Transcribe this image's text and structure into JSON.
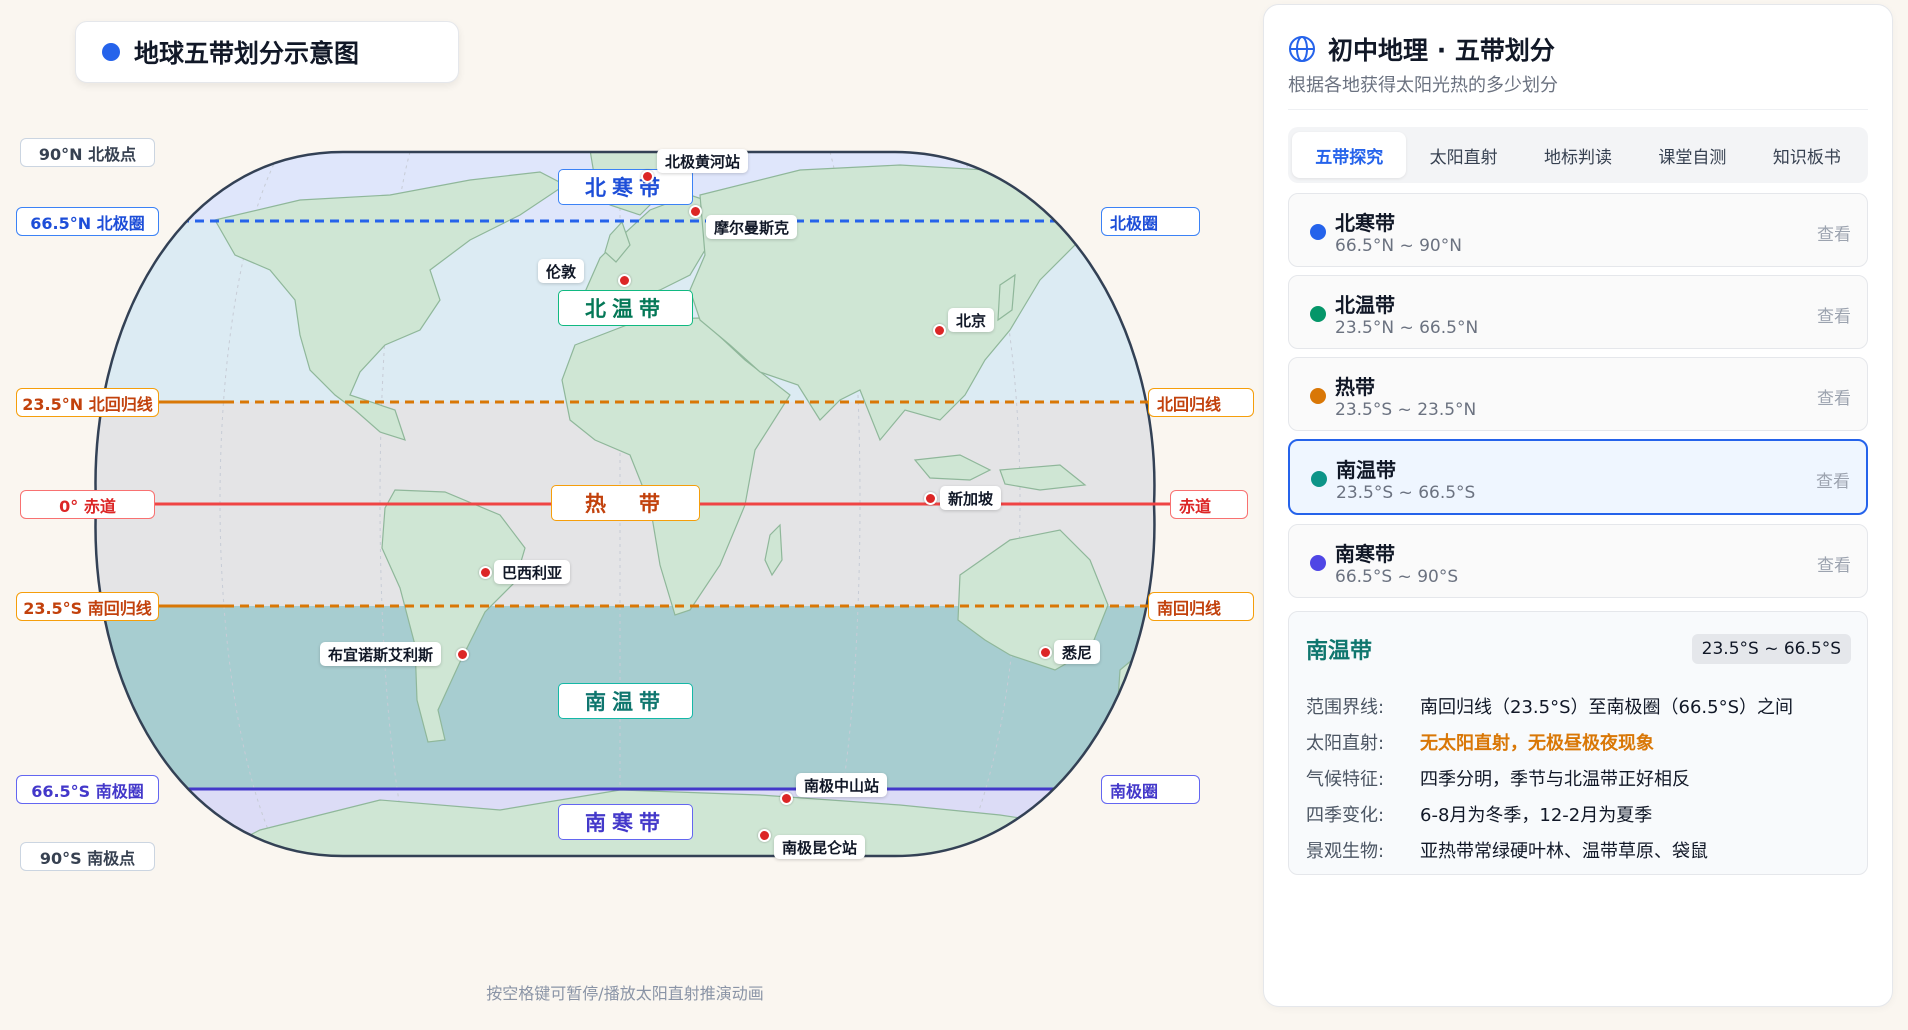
{
  "header": {
    "title": "地球五带划分示意图",
    "accent": "#2563eb"
  },
  "map": {
    "left_labels": [
      {
        "key": "np",
        "text": "90°N 北极点",
        "color": "#374151"
      },
      {
        "key": "arctic",
        "text": "66.5°N 北极圈",
        "color": "#1d4ed8"
      },
      {
        "key": "cancer",
        "text": "23.5°N 北回归线",
        "color": "#c2410c"
      },
      {
        "key": "equator",
        "text": "0° 赤道",
        "color": "#dc2626"
      },
      {
        "key": "capricorn",
        "text": "23.5°S 南回归线",
        "color": "#c2410c"
      },
      {
        "key": "antarctic",
        "text": "66.5°S 南极圈",
        "color": "#4338ca"
      },
      {
        "key": "sp",
        "text": "90°S 南极点",
        "color": "#374151"
      }
    ],
    "right_labels": [
      {
        "key": "arctic",
        "text": "北极圈",
        "color": "#1d4ed8"
      },
      {
        "key": "cancer",
        "text": "北回归线",
        "color": "#c2410c"
      },
      {
        "key": "equator",
        "text": "赤道",
        "color": "#dc2626"
      },
      {
        "key": "capricorn",
        "text": "南回归线",
        "color": "#c2410c"
      },
      {
        "key": "antarctic",
        "text": "南极圈",
        "color": "#4338ca"
      }
    ],
    "zone_labels": [
      {
        "text": "北寒带",
        "color": "#1d4ed8"
      },
      {
        "text": "北温带",
        "color": "#047857"
      },
      {
        "text": "热　带",
        "color": "#c2410c"
      },
      {
        "text": "南温带",
        "color": "#0f766e"
      },
      {
        "text": "南寒带",
        "color": "#4338ca"
      }
    ],
    "cities": [
      {
        "name": "北极黄河站"
      },
      {
        "name": "摩尔曼斯克"
      },
      {
        "name": "伦敦"
      },
      {
        "name": "北京"
      },
      {
        "name": "新加坡"
      },
      {
        "name": "巴西利亚"
      },
      {
        "name": "布宜诺斯艾利斯"
      },
      {
        "name": "悉尼"
      },
      {
        "name": "南极中山站"
      },
      {
        "name": "南极昆仑站"
      }
    ],
    "hint": "按空格键可暂停/播放太阳直射推演动画"
  },
  "panel": {
    "title": "初中地理 · 五带划分",
    "subtitle": "根据各地获得太阳光热的多少划分",
    "tabs": [
      "五带探究",
      "太阳直射",
      "地标判读",
      "课堂自测",
      "知识板书"
    ],
    "active_tab": 0,
    "zones": [
      {
        "name": "北寒带",
        "range": "66.5°N ~ 90°N",
        "color": "#2563eb",
        "view": "查看"
      },
      {
        "name": "北温带",
        "range": "23.5°N ~ 66.5°N",
        "color": "#059669",
        "view": "查看"
      },
      {
        "name": "热带",
        "range": "23.5°S ~ 23.5°N",
        "color": "#d97706",
        "view": "查看"
      },
      {
        "name": "南温带",
        "range": "23.5°S ~ 66.5°S",
        "color": "#0d9488",
        "view": "查看"
      },
      {
        "name": "南寒带",
        "range": "66.5°S ~ 90°S",
        "color": "#4f46e5",
        "view": "查看"
      }
    ],
    "active_zone": 3,
    "detail": {
      "title": "南温带",
      "badge": "23.5°S ~ 66.5°S",
      "rows": [
        {
          "key": "范围界线:",
          "value": "南回归线（23.5°S）至南极圈（66.5°S）之间"
        },
        {
          "key": "太阳直射:",
          "value": "无太阳直射，无极昼极夜现象"
        },
        {
          "key": "气候特征:",
          "value": "四季分明，季节与北温带正好相反"
        },
        {
          "key": "四季变化:",
          "value": "6-8月为冬季，12-2月为夏季"
        },
        {
          "key": "景观生物:",
          "value": "亚热带常绿硬叶林、温带草原、袋鼠"
        }
      ]
    }
  }
}
